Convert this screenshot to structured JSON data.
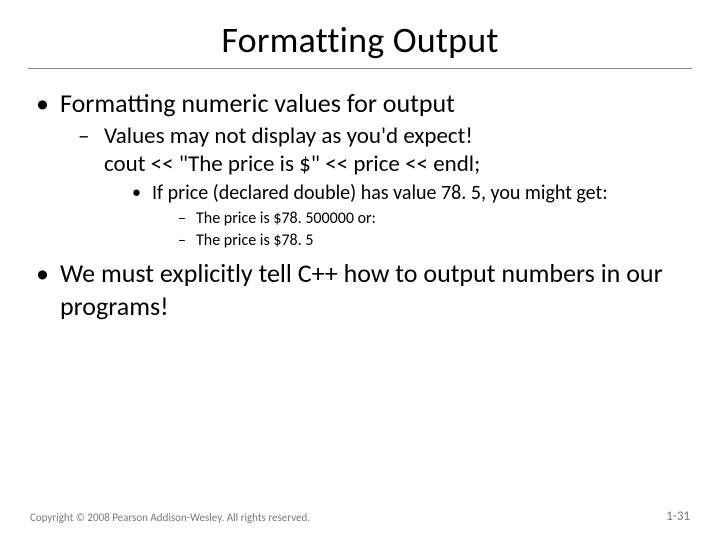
{
  "title": "Formatting Output",
  "bullets": {
    "b1": "Formatting numeric values for output",
    "b1_1_line1": "Values may not display as you'd expect!",
    "b1_1_line2": "cout << \"The price is $\" << price << endl;",
    "b1_1_1": "If price (declared double) has value 78. 5, you might get:",
    "b1_1_1_1": "The price is $78. 500000   or:",
    "b1_1_1_2": "The price is $78. 5",
    "b2": "We must explicitly tell C++ how to output numbers in our programs!"
  },
  "footer": {
    "copyright": "Copyright © 2008 Pearson Addison-Wesley. All rights reserved.",
    "pagenum": "1-31"
  }
}
